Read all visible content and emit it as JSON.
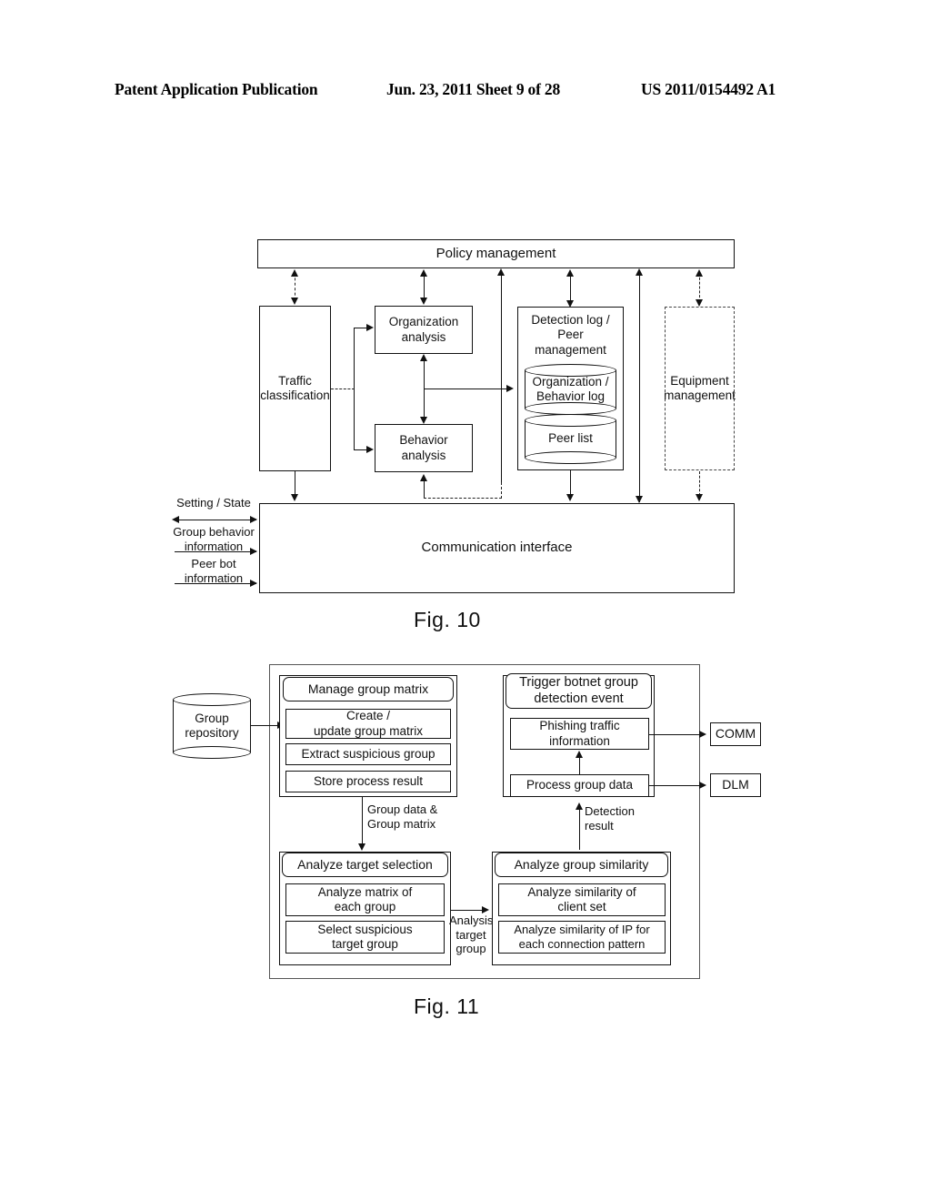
{
  "header": {
    "left": "Patent Application Publication",
    "middle": "Jun. 23, 2011  Sheet 9 of 28",
    "right": "US 2011/0154492 A1"
  },
  "fig10": {
    "caption": "Fig. 10",
    "policy_management": "Policy management",
    "traffic_classification": "Traffic\nclassification",
    "organization_analysis": "Organization\nanalysis",
    "behavior_analysis": "Behavior\nanalysis",
    "detection_log": "Detection log /\nPeer management",
    "organization_behavior_log": "Organization /\nBehavior log",
    "peer_list": "Peer list",
    "equipment_management": "Equipment\nmanagement",
    "communication_interface": "Communication interface",
    "left_labels": [
      "Setting / State",
      "Group behavior\ninformation",
      "Peer bot\ninformation"
    ]
  },
  "fig11": {
    "caption": "Fig. 11",
    "group_repository": "Group\nrepository",
    "manage_group_matrix": {
      "title": "Manage group matrix",
      "items": [
        "Create /\nupdate group matrix",
        "Extract suspicious group",
        "Store process result"
      ]
    },
    "trigger_event": {
      "title": "Trigger botnet group\ndetection event",
      "items": [
        "Phishing traffic\ninformation",
        "Process group data"
      ]
    },
    "analyze_target_selection": {
      "title": "Analyze target selection",
      "items": [
        "Analyze matrix of\neach group",
        "Select suspicious\ntarget group"
      ]
    },
    "analyze_group_similarity": {
      "title": "Analyze group similarity",
      "items": [
        "Analyze similarity of\nclient set",
        "Analyze similarity of IP for\neach connection pattern"
      ]
    },
    "external": {
      "comm": "COMM",
      "dlm": "DLM"
    },
    "edge_labels": {
      "group_data_matrix": "Group data &\nGroup matrix",
      "detection_result": "Detection\nresult",
      "analysis_target_group": "Analysis\ntarget\ngroup"
    }
  }
}
